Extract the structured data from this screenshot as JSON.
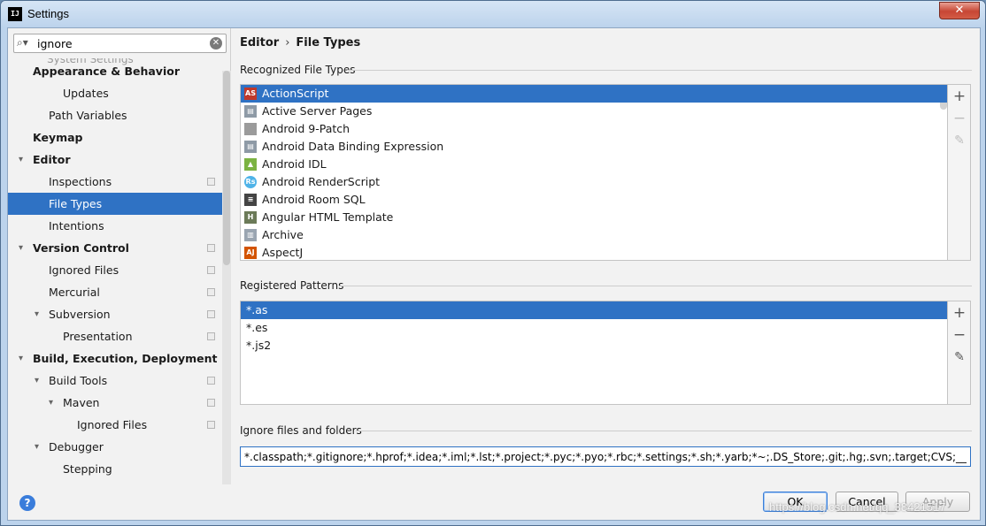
{
  "window": {
    "title": "Settings",
    "close_label": "✕"
  },
  "search": {
    "value": "ignore"
  },
  "sidebar": {
    "clipped_label": "System Settings",
    "items": [
      {
        "label": "Appearance & Behavior",
        "bold": true,
        "indent": 0,
        "arrow": "",
        "proj": false
      },
      {
        "label": "Updates",
        "bold": false,
        "indent": 2,
        "arrow": "",
        "proj": false
      },
      {
        "label": "Path Variables",
        "bold": false,
        "indent": 1,
        "arrow": "",
        "proj": false
      },
      {
        "label": "Keymap",
        "bold": true,
        "indent": 0,
        "arrow": "",
        "proj": false
      },
      {
        "label": "Editor",
        "bold": true,
        "indent": 0,
        "arrow": "▾",
        "proj": false
      },
      {
        "label": "Inspections",
        "bold": false,
        "indent": 1,
        "arrow": "",
        "proj": true
      },
      {
        "label": "File Types",
        "bold": false,
        "indent": 1,
        "arrow": "",
        "proj": false,
        "selected": true
      },
      {
        "label": "Intentions",
        "bold": false,
        "indent": 1,
        "arrow": "",
        "proj": false
      },
      {
        "label": "Version Control",
        "bold": true,
        "indent": 0,
        "arrow": "▾",
        "proj": true
      },
      {
        "label": "Ignored Files",
        "bold": false,
        "indent": 1,
        "arrow": "",
        "proj": true
      },
      {
        "label": "Mercurial",
        "bold": false,
        "indent": 1,
        "arrow": "",
        "proj": true
      },
      {
        "label": "Subversion",
        "bold": false,
        "indent": 1,
        "arrow": "▾",
        "proj": true
      },
      {
        "label": "Presentation",
        "bold": false,
        "indent": 2,
        "arrow": "",
        "proj": true
      },
      {
        "label": "Build, Execution, Deployment",
        "bold": true,
        "indent": 0,
        "arrow": "▾",
        "proj": false
      },
      {
        "label": "Build Tools",
        "bold": false,
        "indent": 1,
        "arrow": "▾",
        "proj": true
      },
      {
        "label": "Maven",
        "bold": false,
        "indent": 2,
        "arrow": "▾",
        "proj": true
      },
      {
        "label": "Ignored Files",
        "bold": false,
        "indent": 3,
        "arrow": "",
        "proj": true
      },
      {
        "label": "Debugger",
        "bold": false,
        "indent": 1,
        "arrow": "▾",
        "proj": false
      },
      {
        "label": "Stepping",
        "bold": false,
        "indent": 2,
        "arrow": "",
        "proj": false
      }
    ]
  },
  "breadcrumb": {
    "part1": "Editor",
    "sep": "›",
    "part2": "File Types"
  },
  "recognized": {
    "title": "Recognized File Types",
    "items": [
      {
        "label": "ActionScript",
        "icon": "actionscript-icon",
        "color": "#c0392b",
        "glyph": "AS",
        "selected": true
      },
      {
        "label": "Active Server Pages",
        "icon": "asp-icon",
        "color": "#8e9aa6",
        "glyph": "▤"
      },
      {
        "label": "Android 9-Patch",
        "icon": "folder-icon",
        "color": "#9b9b9b",
        "glyph": ""
      },
      {
        "label": "Android Data Binding Expression",
        "icon": "file-icon",
        "color": "#8e9aa6",
        "glyph": "▤"
      },
      {
        "label": "Android IDL",
        "icon": "android-icon",
        "color": "#7cb342",
        "glyph": "▲"
      },
      {
        "label": "Android RenderScript",
        "icon": "renderscript-icon",
        "color": "#4fb3e8",
        "glyph": "Rs"
      },
      {
        "label": "Android Room SQL",
        "icon": "database-icon",
        "color": "#444444",
        "glyph": "≡"
      },
      {
        "label": "Angular HTML Template",
        "icon": "html-icon",
        "color": "#6b7a58",
        "glyph": "H"
      },
      {
        "label": "Archive",
        "icon": "archive-icon",
        "color": "#9aa5b1",
        "glyph": "▥"
      },
      {
        "label": "AspectJ",
        "icon": "aspectj-icon",
        "color": "#d35400",
        "glyph": "AJ"
      }
    ]
  },
  "patterns": {
    "title": "Registered Patterns",
    "items": [
      {
        "label": "*.as",
        "selected": true
      },
      {
        "label": "*.es"
      },
      {
        "label": "*.js2"
      }
    ]
  },
  "toolbar": {
    "add": "+",
    "remove": "−",
    "edit": "✎"
  },
  "ignore": {
    "title": "Ignore files and folders",
    "value": "*.classpath;*.gitignore;*.hprof;*.idea;*.iml;*.lst;*.project;*.pyc;*.pyo;*.rbc;*.settings;*.sh;*.yarb;*~;.DS_Store;.git;.hg;.svn;.target;CVS;__pycache__;_s"
  },
  "buttons": {
    "ok": "OK",
    "cancel": "Cancel",
    "apply": "Apply",
    "help": "?"
  },
  "watermark": "https://blog.csdn.net/qq_38421517"
}
